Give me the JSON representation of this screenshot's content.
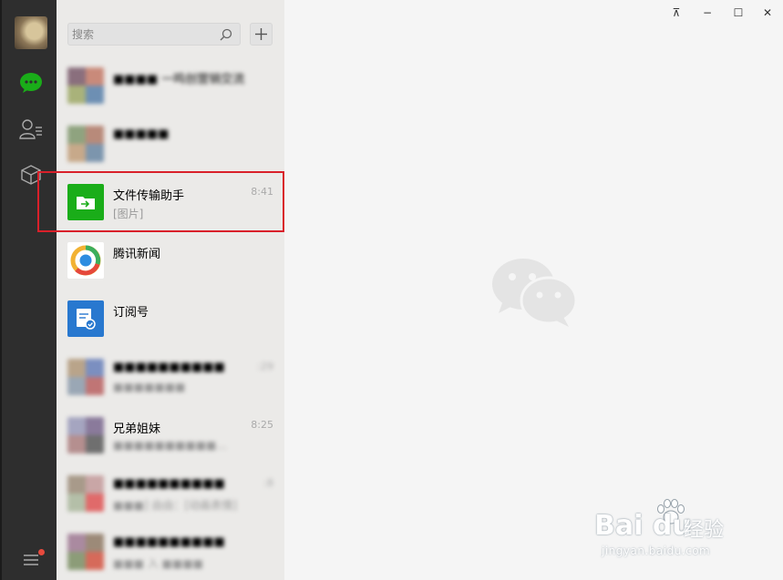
{
  "colors": {
    "nav_bg": "#2e2e2e",
    "list_bg": "#ebeae8",
    "main_bg": "#f5f5f5",
    "accent_green": "#1aad19",
    "highlight_red": "#d9202a"
  },
  "nav": {
    "items": [
      {
        "name": "chat",
        "icon": "chat-bubble-icon",
        "active": true
      },
      {
        "name": "contacts",
        "icon": "contacts-icon",
        "active": false
      },
      {
        "name": "favorites",
        "icon": "cube-icon",
        "active": false
      }
    ],
    "menu_icon": "menu-icon"
  },
  "search": {
    "placeholder": "搜索",
    "value": ""
  },
  "add_label": "+",
  "chats": [
    {
      "name": "■■■■ 一鸣创营销交流",
      "preview": "",
      "time": "",
      "avatar": "group-avatar",
      "blurred": true
    },
    {
      "name": "■■■■■",
      "preview": "",
      "time": "",
      "avatar": "group-avatar",
      "blurred": true
    },
    {
      "name": "文件传输助手",
      "preview": "[图片]",
      "time": "8:41",
      "avatar": "file-transfer-icon",
      "blurred": false
    },
    {
      "name": "腾讯新闻",
      "preview": "",
      "time": "",
      "avatar": "tencent-news-icon",
      "blurred": false
    },
    {
      "name": "订阅号",
      "preview": "",
      "time": "",
      "avatar": "subscription-icon",
      "blurred": false
    },
    {
      "name": "■■■■■■■■■■",
      "preview": "■■■■■■■",
      "time": ":29",
      "avatar": "group-avatar",
      "blurred": true
    },
    {
      "name": "兄弟姐妹",
      "preview": "■■■■■■■■■■...",
      "time": "8:25",
      "avatar": "group-avatar",
      "blurred": true
    },
    {
      "name": "■■■■■■■■■■",
      "preview": "■■■] 由由：[动画表情]",
      "time": ":8",
      "avatar": "group-avatar",
      "blurred": true
    },
    {
      "name": "■■■■■■■■■■",
      "preview": "■■■ 入 ■■■■",
      "time": "",
      "avatar": "group-avatar",
      "blurred": true
    }
  ],
  "window_controls": {
    "pin": "⊼",
    "minimize": "−",
    "maximize": "☐",
    "close": "✕"
  },
  "watermark": {
    "main": "Bai du",
    "cn": "经验",
    "sub": "jingyan.baidu.com"
  }
}
